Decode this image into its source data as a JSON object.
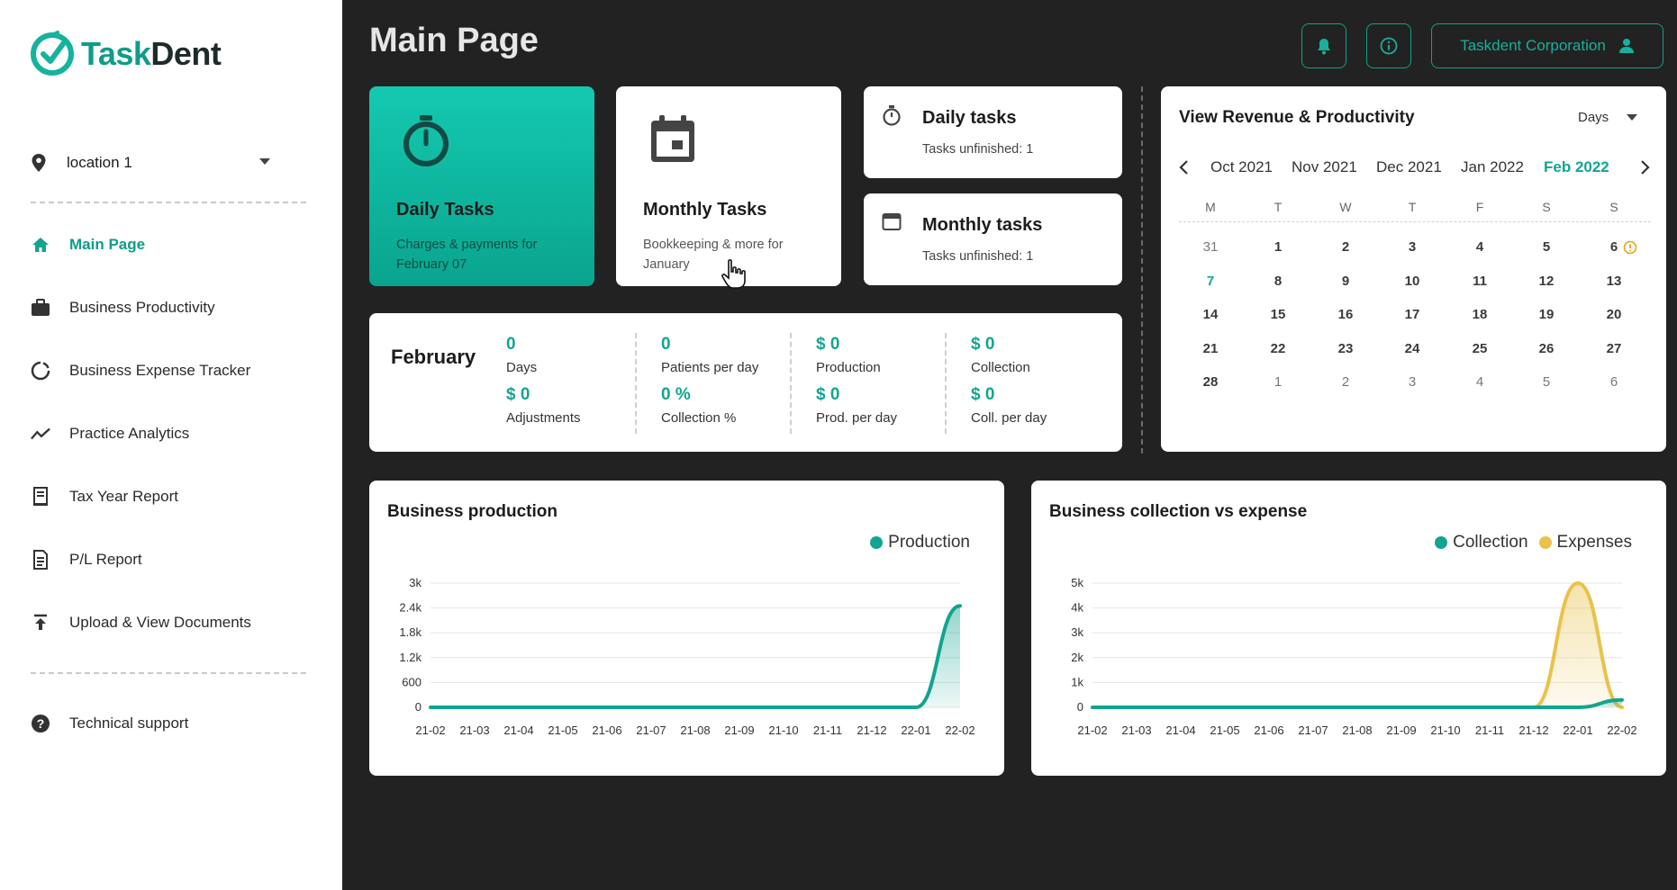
{
  "app": {
    "logo_text_a": "Task",
    "logo_text_b": "Dent",
    "accent": "#13a48f"
  },
  "sidebar": {
    "location": "location 1",
    "items": [
      {
        "label": "Main Page",
        "icon": "home-icon",
        "active": true
      },
      {
        "label": "Business Productivity",
        "icon": "briefcase-icon"
      },
      {
        "label": "Business Expense Tracker",
        "icon": "cycle-icon"
      },
      {
        "label": "Practice Analytics",
        "icon": "trend-line-icon"
      },
      {
        "label": "Tax Year Report",
        "icon": "receipt-icon"
      },
      {
        "label": "P/L Report",
        "icon": "document-icon"
      },
      {
        "label": "Upload & View Documents",
        "icon": "upload-icon"
      }
    ],
    "support": {
      "label": "Technical support",
      "icon": "help-circle-icon"
    }
  },
  "header": {
    "title": "Main Page",
    "company": "Taskdent Corporation"
  },
  "cards": {
    "daily": {
      "title": "Daily Tasks",
      "subtitle": "Charges & payments for February 07"
    },
    "monthly": {
      "title": "Monthly Tasks",
      "subtitle": "Bookkeeping & more for January"
    },
    "daily_small": {
      "title": "Daily tasks",
      "subtitle": "Tasks unfinished: 1"
    },
    "monthly_small": {
      "title": "Monthly tasks",
      "subtitle": "Tasks unfinished: 1"
    }
  },
  "stats": {
    "month": "February",
    "items": [
      {
        "value": "0",
        "label": "Days"
      },
      {
        "value": "$ 0",
        "label": "Adjustments"
      },
      {
        "value": "0",
        "label": "Patients per day"
      },
      {
        "value": "0 %",
        "label": "Collection %"
      },
      {
        "value": "$ 0",
        "label": "Production"
      },
      {
        "value": "$ 0",
        "label": "Prod. per day"
      },
      {
        "value": "$ 0",
        "label": "Collection"
      },
      {
        "value": "$ 0",
        "label": "Coll. per day"
      }
    ]
  },
  "calendar": {
    "title": "View Revenue & Productivity",
    "mode": "Days",
    "months": [
      "Oct 2021",
      "Nov 2021",
      "Dec 2021",
      "Jan 2022",
      "Feb 2022"
    ],
    "selected_month": "Feb 2022",
    "weekdays": [
      "M",
      "T",
      "W",
      "T",
      "F",
      "S",
      "S"
    ],
    "weeks": [
      [
        "31",
        "1",
        "2",
        "3",
        "4",
        "5",
        "6"
      ],
      [
        "7",
        "8",
        "9",
        "10",
        "11",
        "12",
        "13"
      ],
      [
        "14",
        "15",
        "16",
        "17",
        "18",
        "19",
        "20"
      ],
      [
        "21",
        "22",
        "23",
        "24",
        "25",
        "26",
        "27"
      ],
      [
        "28",
        "1",
        "2",
        "3",
        "4",
        "5",
        "6"
      ]
    ],
    "today": "7",
    "warning_day": "6"
  },
  "chart_data": [
    {
      "type": "area",
      "title": "Business production",
      "x": [
        "21-02",
        "21-03",
        "21-04",
        "21-05",
        "21-06",
        "21-07",
        "21-08",
        "21-09",
        "21-10",
        "21-11",
        "21-12",
        "22-01",
        "22-02"
      ],
      "yticks": [
        "3k",
        "2.4k",
        "1.8k",
        "1.2k",
        "600",
        "0"
      ],
      "ylim": [
        0,
        3000
      ],
      "series": [
        {
          "name": "Production",
          "color": "#13a48f",
          "values": [
            0,
            0,
            0,
            0,
            0,
            0,
            0,
            0,
            0,
            0,
            0,
            0,
            2450
          ]
        }
      ],
      "legend": "top-right",
      "grid": true
    },
    {
      "type": "area",
      "title": "Business collection vs expense",
      "x": [
        "21-02",
        "21-03",
        "21-04",
        "21-05",
        "21-06",
        "21-07",
        "21-08",
        "21-09",
        "21-10",
        "21-11",
        "21-12",
        "22-01",
        "22-02"
      ],
      "yticks": [
        "5k",
        "4k",
        "3k",
        "2k",
        "1k",
        "0"
      ],
      "ylim": [
        0,
        5000
      ],
      "series": [
        {
          "name": "Collection",
          "color": "#13a48f",
          "values": [
            0,
            0,
            0,
            0,
            0,
            0,
            0,
            0,
            0,
            0,
            0,
            0,
            300
          ]
        },
        {
          "name": "Expenses",
          "color": "#e9c24a",
          "values": [
            0,
            0,
            0,
            0,
            0,
            0,
            0,
            0,
            0,
            0,
            0,
            5000,
            0
          ]
        }
      ],
      "legend": "top-right",
      "grid": true
    }
  ]
}
